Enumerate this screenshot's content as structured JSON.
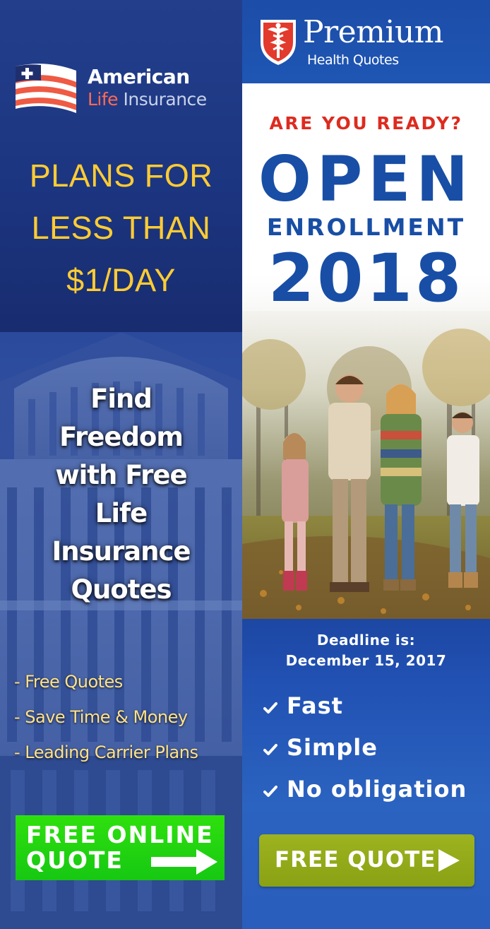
{
  "left_ad": {
    "brand": {
      "name_line1": "American",
      "name_word_life": "Life",
      "name_word_insurance": "Insurance"
    },
    "headline": [
      "PLANS FOR",
      "LESS THAN",
      "$1/DAY"
    ],
    "tagline": [
      "Find",
      "Freedom",
      "with Free",
      "Life",
      "Insurance",
      "Quotes"
    ],
    "features": [
      "- Free Quotes",
      "- Save Time & Money",
      "- Leading Carrier Plans"
    ],
    "cta": {
      "line1": "FREE ONLINE",
      "line2": "QUOTE"
    },
    "colors": {
      "headline": "#ffcc33",
      "features": "#ffe28a",
      "cta": "#22d411",
      "life_word": "#ff6a55"
    }
  },
  "right_ad": {
    "brand": {
      "name": "Premium",
      "subtitle": "Health Quotes"
    },
    "kicker": "ARE YOU READY?",
    "title_line1": "OPEN",
    "title_line2": "ENROLLMENT",
    "title_year": "2018",
    "deadline_line1": "Deadline is:",
    "deadline_line2": "December 15, 2017",
    "benefits": [
      "Fast",
      "Simple",
      "No obligation"
    ],
    "cta": "FREE QUOTE",
    "colors": {
      "kicker": "#dd2b1f",
      "title": "#184ea5",
      "cta": "#96ab1a",
      "background_blue": "#1f56b4"
    }
  }
}
